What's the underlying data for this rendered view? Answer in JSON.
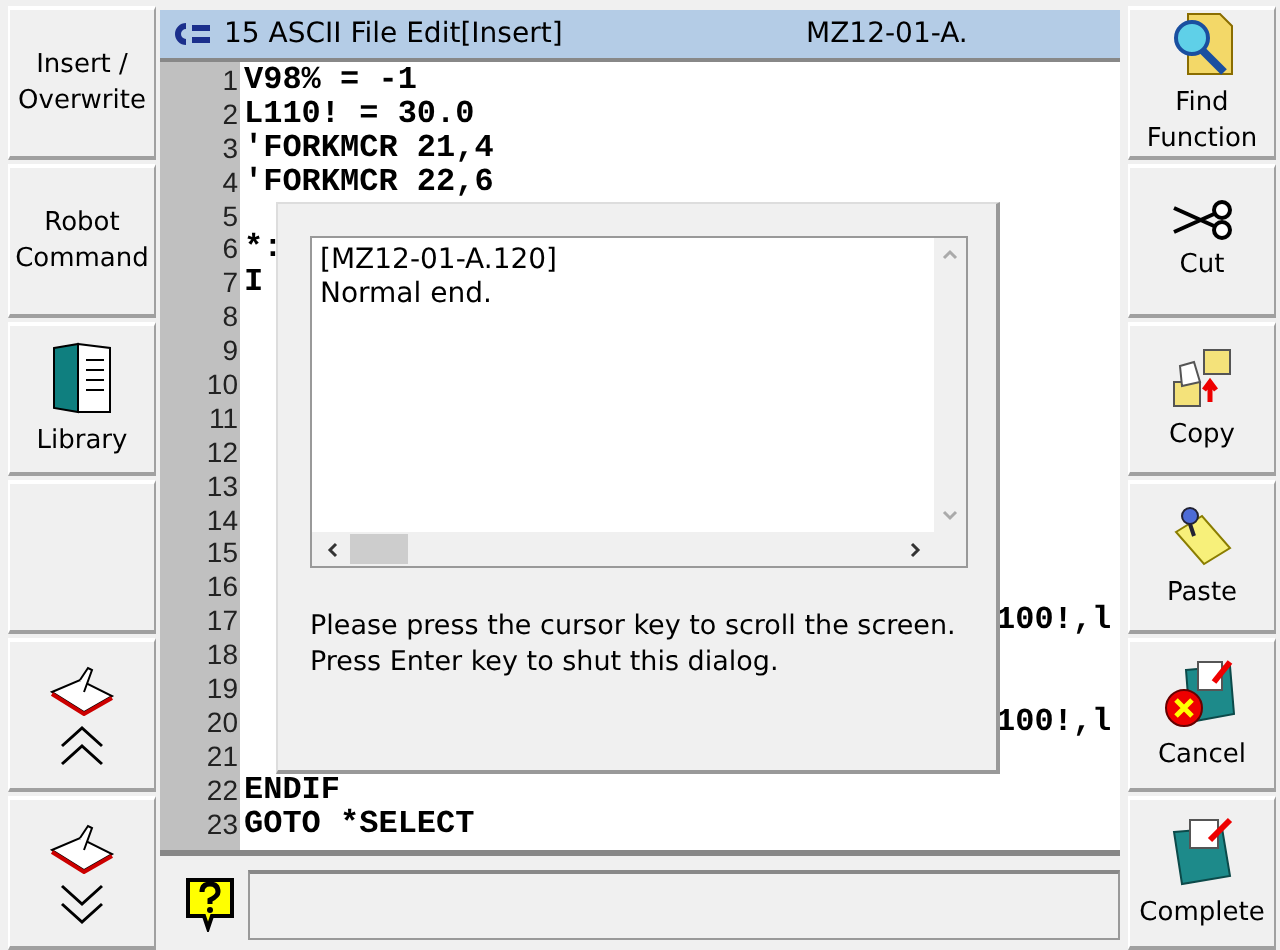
{
  "left_buttons": [
    {
      "kind": "text",
      "label": "Insert / Overwrite"
    },
    {
      "kind": "text",
      "label": "Robot Command"
    },
    {
      "kind": "library",
      "label": "Library"
    },
    {
      "kind": "blank"
    },
    {
      "kind": "page_up"
    },
    {
      "kind": "page_down"
    }
  ],
  "window": {
    "title": "15 ASCII File Edit[Insert]",
    "file": "MZ12-01-A."
  },
  "editor": {
    "lines": [
      {
        "number": "1",
        "text": "V98% = -1"
      },
      {
        "number": "2",
        "text": "L110! = 30.0"
      },
      {
        "number": "3",
        "text": "'FORKMCR 21,4"
      },
      {
        "number": "4",
        "text": "'FORKMCR 22,6"
      },
      {
        "number": "5"
      },
      {
        "number": "6",
        "text": "*:"
      },
      {
        "number": "7",
        "text": "I"
      },
      {
        "number": "8"
      },
      {
        "number": "9"
      },
      {
        "number": "10"
      },
      {
        "number": "11"
      },
      {
        "number": "12"
      },
      {
        "number": "13"
      },
      {
        "number": "14"
      },
      {
        "number": "15"
      },
      {
        "number": "16"
      },
      {
        "number": "17",
        "tail": "100!,l"
      },
      {
        "number": "18"
      },
      {
        "number": "19"
      },
      {
        "number": "20",
        "tail": "100!,l"
      },
      {
        "number": "21"
      },
      {
        "number": "22",
        "text": "ENDIF"
      },
      {
        "number": "23",
        "text": "GOTO *SELECT"
      }
    ]
  },
  "dialog": {
    "log": [
      "[MZ12-01-A.120]",
      "Normal end."
    ],
    "message": "Please press the cursor key to scroll the screen. Press Enter key to shut this dialog."
  },
  "right_buttons": [
    {
      "kind": "find",
      "label": "Find Function"
    },
    {
      "kind": "cut",
      "label": "Cut"
    },
    {
      "kind": "copy",
      "label": "Copy"
    },
    {
      "kind": "paste",
      "label": "Paste"
    },
    {
      "kind": "cancel",
      "label": "Cancel"
    },
    {
      "kind": "complete",
      "label": "Complete"
    }
  ]
}
